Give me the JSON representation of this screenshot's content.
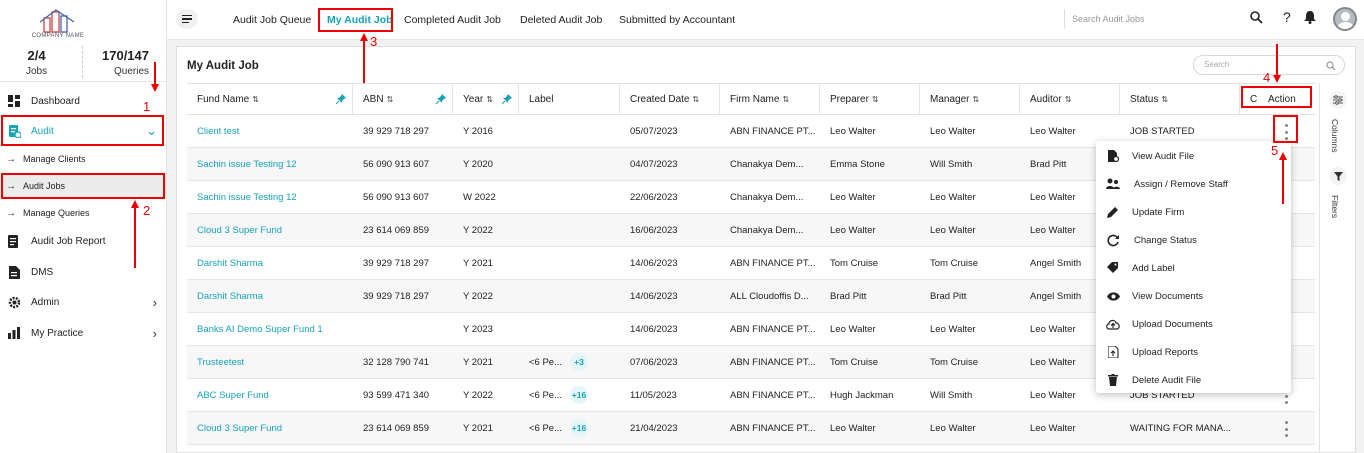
{
  "app": {
    "logo_text": "COMPANY NAME"
  },
  "stats": {
    "jobs_value": "2/4",
    "jobs_label": "Jobs",
    "queries_value": "170/147",
    "queries_label": "Queries"
  },
  "sidebar": {
    "dashboard": "Dashboard",
    "audit": "Audit",
    "manage_clients": "Manage Clients",
    "audit_jobs": "Audit Jobs",
    "manage_queries": "Manage Queries",
    "audit_job_report": "Audit Job Report",
    "dms": "DMS",
    "admin": "Admin",
    "my_practice": "My Practice"
  },
  "topnav": {
    "tabs": [
      "Audit Job Queue",
      "My Audit Job",
      "Completed Audit Job",
      "Deleted Audit Job",
      "Submitted by Accountant"
    ],
    "search_placeholder": "Search Audit Jobs",
    "help": "?"
  },
  "panel": {
    "title": "My Audit Job",
    "search_placeholder": "Search"
  },
  "columns": {
    "fund_name": "Fund Name",
    "abn": "ABN",
    "year": "Year",
    "label": "Label",
    "created_date": "Created Date",
    "firm_name": "Firm Name",
    "preparer": "Preparer",
    "manager": "Manager",
    "auditor": "Auditor",
    "status": "Status",
    "action_prefix": "C",
    "action": "Action"
  },
  "rows": [
    {
      "fund": "Client test",
      "abn": "39 929 718 297",
      "year": "Y 2016",
      "label": "",
      "badge": "",
      "created": "05/07/2023",
      "firm": "ABN FINANCE PT...",
      "preparer": "Leo Walter",
      "manager": "Leo Walter",
      "auditor": "Leo Walter",
      "status": "JOB STARTED"
    },
    {
      "fund": "Sachin issue Testing 12",
      "abn": "56 090 913 607",
      "year": "Y 2020",
      "label": "",
      "badge": "",
      "created": "04/07/2023",
      "firm": "Chanakya Dem...",
      "preparer": "Emma Stone",
      "manager": "Will Smith",
      "auditor": "Brad Pitt",
      "status": ""
    },
    {
      "fund": "Sachin issue Testing 12",
      "abn": "56 090 913 607",
      "year": "W 2022",
      "label": "",
      "badge": "",
      "created": "22/06/2023",
      "firm": "Chanakya Dem...",
      "preparer": "Leo Walter",
      "manager": "Leo Walter",
      "auditor": "Leo Walter",
      "status": ""
    },
    {
      "fund": "Cloud 3 Super Fund",
      "abn": "23 614 069 859",
      "year": "Y 2022",
      "label": "",
      "badge": "",
      "created": "16/06/2023",
      "firm": "Chanakya Dem...",
      "preparer": "Leo Walter",
      "manager": "Leo Walter",
      "auditor": "Leo Walter",
      "status": ""
    },
    {
      "fund": "Darshit Sharma",
      "abn": "39 929 718 297",
      "year": "Y 2021",
      "label": "",
      "badge": "",
      "created": "14/06/2023",
      "firm": "ABN FINANCE PT...",
      "preparer": "Tom Cruise",
      "manager": "Tom Cruise",
      "auditor": "Angel Smith",
      "status": ""
    },
    {
      "fund": "Darshit Sharma",
      "abn": "39 929 718 297",
      "year": "Y 2022",
      "label": "",
      "badge": "",
      "created": "14/06/2023",
      "firm": "ALL Cloudoffis D...",
      "preparer": "Brad Pitt",
      "manager": "Brad Pitt",
      "auditor": "Angel Smith",
      "status": ""
    },
    {
      "fund": "Banks AI Demo Super Fund 1",
      "abn": "",
      "year": "Y 2023",
      "label": "",
      "badge": "",
      "created": "14/06/2023",
      "firm": "ABN FINANCE PT...",
      "preparer": "Leo Walter",
      "manager": "Leo Walter",
      "auditor": "Leo Walter",
      "status": ""
    },
    {
      "fund": "Trusteetest",
      "abn": "32 128 790 741",
      "year": "Y 2021",
      "label": "<6 Pe...",
      "badge": "+3",
      "created": "07/06/2023",
      "firm": "ABN FINANCE PT...",
      "preparer": "Tom Cruise",
      "manager": "Tom Cruise",
      "auditor": "Leo Walter",
      "status": ""
    },
    {
      "fund": "ABC Super Fund",
      "abn": "93 599 471 340",
      "year": "Y 2022",
      "label": "<6 Pe...",
      "badge": "+16",
      "created": "11/05/2023",
      "firm": "ABN FINANCE PT...",
      "preparer": "Hugh Jackman",
      "manager": "Will Smith",
      "auditor": "Leo Walter",
      "status": "JOB STARTED"
    },
    {
      "fund": "Cloud 3 Super Fund",
      "abn": "23 614 069 859",
      "year": "Y 2021",
      "label": "<6 Pe...",
      "badge": "+16",
      "created": "21/04/2023",
      "firm": "ABN FINANCE PT...",
      "preparer": "Leo Walter",
      "manager": "Leo Walter",
      "auditor": "Leo Walter",
      "status": "WAITING FOR MANA..."
    }
  ],
  "action_menu": [
    "View Audit File",
    "Assign / Remove Staff",
    "Update Firm",
    "Change Status",
    "Add Label",
    "View Documents",
    "Upload Documents",
    "Upload Reports",
    "Delete Audit File"
  ],
  "side_tools": {
    "columns": "Columns",
    "filters": "Filters"
  },
  "annotations": [
    "1",
    "2",
    "3",
    "4",
    "5"
  ],
  "colors": {
    "accent": "#17a2b8",
    "annotation": "#e00000"
  }
}
